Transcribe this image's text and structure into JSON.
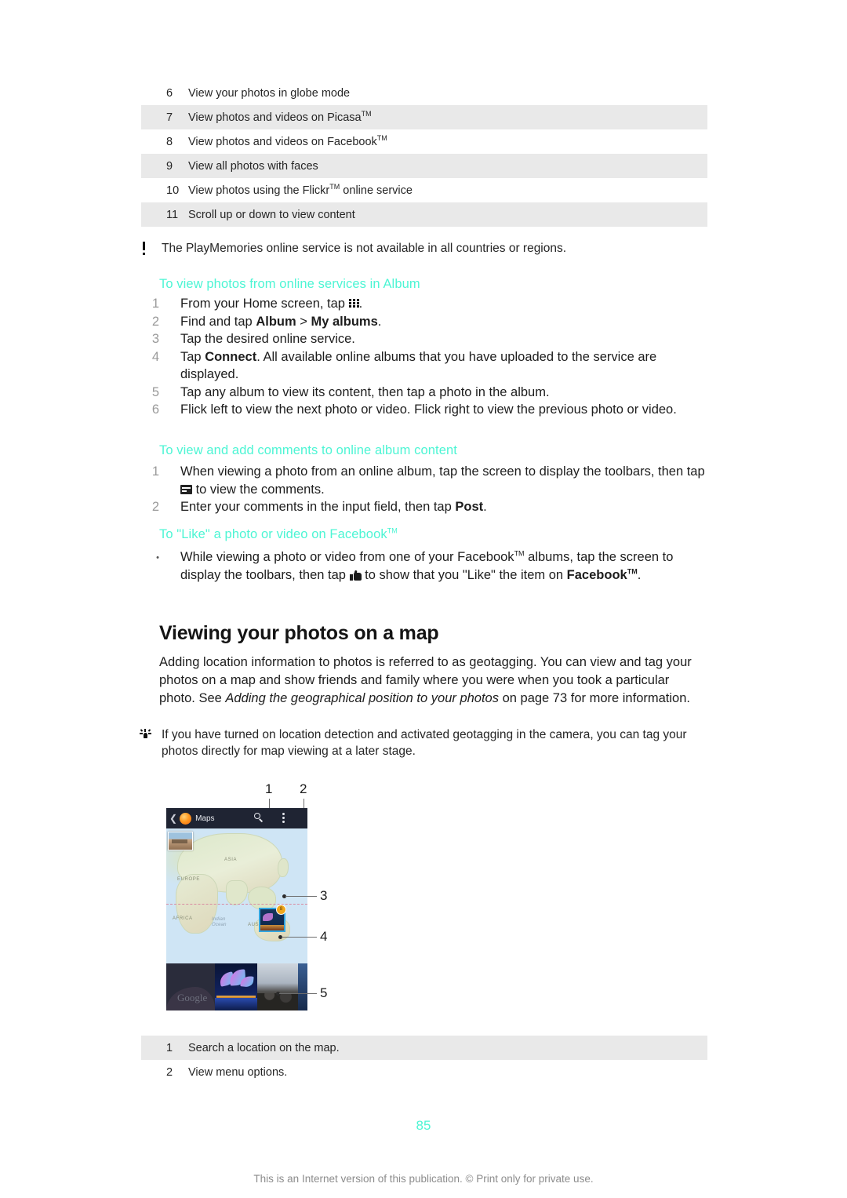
{
  "legend_top": {
    "rows": [
      {
        "num": "6",
        "text": "View your photos in globe mode",
        "shaded": false
      },
      {
        "num": "7",
        "text": "View photos and videos on Picasa™",
        "shaded": true
      },
      {
        "num": "8",
        "text": "View photos and videos on Facebook™",
        "shaded": false
      },
      {
        "num": "9",
        "text": "View all photos with faces",
        "shaded": true
      },
      {
        "num": "10",
        "text": "View photos using the Flickr™ online service",
        "shaded": false
      },
      {
        "num": "11",
        "text": "Scroll up or down to view content",
        "shaded": true
      }
    ]
  },
  "note_playmemories": {
    "icon": "exclamation-icon",
    "text": "The PlayMemories online service is not available in all countries or regions."
  },
  "section_online_services": {
    "heading": "To view photos from online services in Album",
    "steps": [
      {
        "num": "1",
        "text_before": "From your Home screen, tap ",
        "icon": "apps-grid-icon",
        "text_after": "."
      },
      {
        "num": "2",
        "text": "Find and tap Album > My albums."
      },
      {
        "num": "3",
        "text": "Tap the desired online service."
      },
      {
        "num": "4",
        "text": "Tap Connect. All available online albums that you have uploaded to the service are displayed."
      },
      {
        "num": "5",
        "text": "Tap any album to view its content, then tap a photo in the album."
      },
      {
        "num": "6",
        "text": "Flick left to view the next photo or video. Flick right to view the previous photo or video."
      }
    ]
  },
  "section_comments": {
    "heading": "To view and add comments to online album content",
    "steps": [
      {
        "num": "1",
        "text_before": "When viewing a photo from an online album, tap the screen to display the toolbars, then tap ",
        "icon": "comment-icon",
        "text_after": " to view the comments."
      },
      {
        "num": "2",
        "text": "Enter your comments in the input field, then tap Post."
      }
    ]
  },
  "section_like": {
    "heading": "To \"Like\" a photo or video on Facebook™",
    "bullet": "•",
    "text_before": "While viewing a photo or video from one of your Facebook™ albums, tap the screen to display the toolbars, then tap ",
    "icon": "thumbs-up-icon",
    "text_after": " to show that you \"Like\" the item on Facebook™."
  },
  "section_map": {
    "heading": "Viewing your photos on a map",
    "paragraph_1": "Adding location information to photos is referred to as geotagging. You can view and tag your photos on a map and show friends and family where you were when you took a particular photo. See ",
    "paragraph_italic": "Adding the geographical position to your photos",
    "paragraph_2": " on page 73 for more information."
  },
  "note_geotagging": {
    "icon": "lightbulb-icon",
    "text": "If you have turned on location detection and activated geotagging in the camera, you can tag your photos directly for map viewing at a later stage."
  },
  "figure": {
    "callouts": [
      "1",
      "2",
      "3",
      "4",
      "5"
    ],
    "app_bar": {
      "back_icon": "back-chevron-icon",
      "logo_icon": "maps-logo-icon",
      "title": "Maps",
      "search_icon": "search-icon",
      "more_icon": "overflow-menu-icon"
    },
    "map_labels": {
      "europe": "EUROPE",
      "asia": "ASIA",
      "africa": "AFRICA",
      "australia": "AUSTRA",
      "indian_ocean_line1": "Indian",
      "indian_ocean_line2": "Ocean"
    },
    "cluster_badge": "8",
    "watermark": "Google"
  },
  "legend_bottom": {
    "rows": [
      {
        "num": "1",
        "text": "Search a location on the map.",
        "shaded": true
      },
      {
        "num": "2",
        "text": "View menu options.",
        "shaded": false
      }
    ]
  },
  "page_number": "85",
  "footer": "This is an Internet version of this publication. © Print only for private use."
}
